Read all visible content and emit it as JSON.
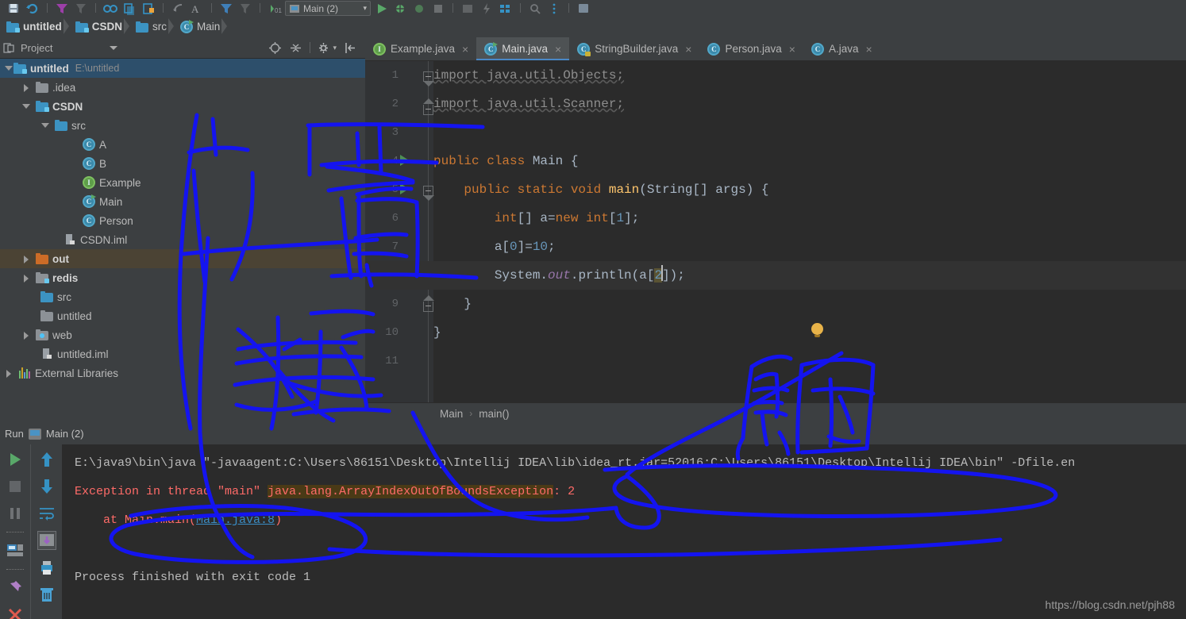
{
  "window": {
    "ide": "IntelliJ IDEA",
    "watermark": "https://blog.csdn.net/pjh88"
  },
  "toolbar": {
    "run_config_label": "Main (2)",
    "icons": [
      "save-icon",
      "sync-icon",
      "filter-icon",
      "flag-icon",
      "undo-icon",
      "redo-icon",
      "copy-icon",
      "paste-icon",
      "back-icon",
      "find-icon",
      "bookmark-icon",
      "run-icon",
      "debug-icon",
      "coverage-icon",
      "stop-icon",
      "settings-icon",
      "structure-icon",
      "search-everywhere-icon"
    ]
  },
  "breadcrumb": {
    "items": [
      {
        "label": "untitled",
        "icon": "module-icon",
        "bold": true
      },
      {
        "label": "CSDN",
        "icon": "module-icon",
        "bold": true
      },
      {
        "label": "src",
        "icon": "folder-icon",
        "bold": false
      },
      {
        "label": "Main",
        "icon": "class-run-icon",
        "bold": false
      }
    ]
  },
  "project_panel": {
    "title": "Project",
    "tools": [
      "locate-icon",
      "collapse-all-icon",
      "settings-gear-icon",
      "hide-icon"
    ],
    "tree": [
      {
        "label": "untitled",
        "path": "E:\\untitled",
        "icon": "module-icon",
        "arrow": "open",
        "indent": 0,
        "bold": true,
        "selected": true
      },
      {
        "label": ".idea",
        "path": "",
        "icon": "folder-gray-icon",
        "arrow": "closed",
        "indent": 1,
        "bold": false,
        "selected": false
      },
      {
        "label": "CSDN",
        "path": "",
        "icon": "module-icon",
        "arrow": "open",
        "indent": 1,
        "bold": true,
        "selected": false
      },
      {
        "label": "src",
        "path": "",
        "icon": "folder-source-icon",
        "arrow": "open",
        "indent": 2,
        "bold": false,
        "selected": false
      },
      {
        "label": "A",
        "path": "",
        "icon": "class-icon",
        "arrow": "none",
        "indent": 3,
        "bold": false,
        "selected": false
      },
      {
        "label": "B",
        "path": "",
        "icon": "class-icon",
        "arrow": "none",
        "indent": 3,
        "bold": false,
        "selected": false
      },
      {
        "label": "Example",
        "path": "",
        "icon": "interface-icon",
        "arrow": "none",
        "indent": 3,
        "bold": false,
        "selected": false
      },
      {
        "label": "Main",
        "path": "",
        "icon": "class-run-icon",
        "arrow": "none",
        "indent": 3,
        "bold": false,
        "selected": false
      },
      {
        "label": "Person",
        "path": "",
        "icon": "class-icon",
        "arrow": "none",
        "indent": 3,
        "bold": false,
        "selected": false
      },
      {
        "label": "CSDN.iml",
        "path": "",
        "icon": "iml-icon",
        "arrow": "none",
        "indent": 2,
        "bold": false,
        "selected": false
      },
      {
        "label": "out",
        "path": "",
        "icon": "folder-excluded-icon",
        "arrow": "closed",
        "indent": 1,
        "bold": true,
        "selected": false,
        "highlight": true
      },
      {
        "label": "redis",
        "path": "",
        "icon": "module-icon",
        "arrow": "closed",
        "indent": 1,
        "bold": true,
        "selected": false
      },
      {
        "label": "src",
        "path": "",
        "icon": "folder-source-icon",
        "arrow": "none",
        "indent": 1,
        "bold": false,
        "selected": false
      },
      {
        "label": "untitled",
        "path": "",
        "icon": "folder-gray-icon",
        "arrow": "none",
        "indent": 1,
        "bold": false,
        "selected": false
      },
      {
        "label": "web",
        "path": "",
        "icon": "folder-web-icon",
        "arrow": "closed",
        "indent": 1,
        "bold": false,
        "selected": false
      },
      {
        "label": "untitled.iml",
        "path": "",
        "icon": "iml-icon",
        "arrow": "none",
        "indent": 1,
        "bold": false,
        "selected": false
      },
      {
        "label": "External Libraries",
        "path": "",
        "icon": "libraries-icon",
        "arrow": "closed",
        "indent": 0,
        "bold": false,
        "selected": false
      }
    ]
  },
  "editor": {
    "tabs": [
      {
        "label": "Example.java",
        "icon": "interface-icon",
        "active": false
      },
      {
        "label": "Main.java",
        "icon": "class-run-icon",
        "active": true
      },
      {
        "label": "StringBuilder.java",
        "icon": "class-locked-icon",
        "active": false
      },
      {
        "label": "Person.java",
        "icon": "class-icon",
        "active": false
      },
      {
        "label": "A.java",
        "icon": "class-icon",
        "active": false
      }
    ],
    "close_glyph": "×",
    "line_numbers": [
      "1",
      "2",
      "3",
      "4",
      "5",
      "6",
      "7",
      "8",
      "9",
      "10",
      "11"
    ],
    "code_lines": [
      "import java.util.Objects;",
      "import java.util.Scanner;",
      "",
      "public class Main {",
      "    public static void main(String[] args) {",
      "        int[] a=new int[1];",
      "        a[0]=10;",
      "        System.out.println(a[2]);",
      "    }",
      "}",
      ""
    ],
    "highlighted_line": 8,
    "caret_line": 8,
    "breadcrumb": {
      "class": "Main",
      "method": "main()",
      "separator": "›"
    }
  },
  "run_window": {
    "tab_label": "Run",
    "config_name": "Main (2)",
    "rail_left_icons": [
      "rerun-icon",
      "stop-icon",
      "pause-icon",
      "layout-icon",
      "pin-icon",
      "close-icon"
    ],
    "rail_right_icons": [
      "up-arrow-icon",
      "down-arrow-icon",
      "soft-wrap-icon",
      "scroll-to-end-icon",
      "print-icon",
      "trash-icon"
    ],
    "console": {
      "command_line": "E:\\java9\\bin\\java \"-javaagent:C:\\Users\\86151\\Desktop\\Intellij IDEA\\lib\\idea_rt.jar=52016:C:\\Users\\86151\\Desktop\\Intellij IDEA\\bin\" -Dfile.en",
      "exception_prefix": "Exception in thread \"main\" ",
      "exception_class": "java.lang.ArrayIndexOutOfBoundsException",
      "exception_message": ": 2",
      "stack_at": "    at Main.main(",
      "stack_link": "Main.java:8",
      "stack_close": ")",
      "exit_line": "Process finished with exit code 1"
    }
  },
  "annotations": {
    "description": "hand-drawn blue marker strokes over the screenshot",
    "color": "#1414f0",
    "notes": [
      "chinese-handwriting-left",
      "chinese-handwriting-right",
      "circled-exception-line",
      "bracket-over-gutter"
    ]
  }
}
